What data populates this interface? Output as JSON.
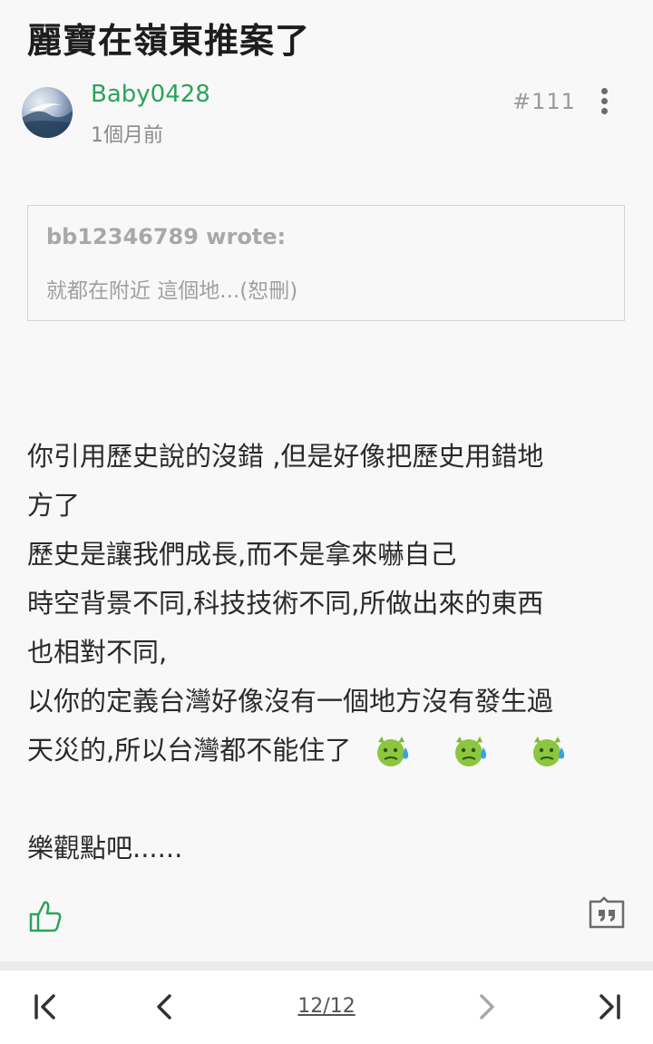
{
  "thread": {
    "title": "麗寶在嶺東推案了"
  },
  "post": {
    "author": "Baby0428",
    "time": "1個月前",
    "floor": "#111",
    "quote": {
      "author": "bb12346789 wrote:",
      "text": "就都在附近 這個地...(恕刪)"
    },
    "content_lines": [
      "你引用歷史說的沒錯 ,但是好像把歷史用錯地",
      "方了",
      "歷史是讓我們成長,而不是拿來嚇自己",
      "時空背景不同,科技技術不同,所做出來的東西",
      "也相對不同,",
      "以你的定義台灣好像沒有一個地方沒有發生過",
      "天災的,所以台灣都不能住了",
      "樂觀點吧......"
    ],
    "emojis": [
      "sweat-devil-icon",
      "sweat-devil-icon",
      "sweat-devil-icon"
    ]
  },
  "pagination": {
    "indicator": "12/12"
  },
  "colors": {
    "author": "#2aa35a",
    "like": "#2aa35a",
    "background": "#f8f8f8"
  }
}
